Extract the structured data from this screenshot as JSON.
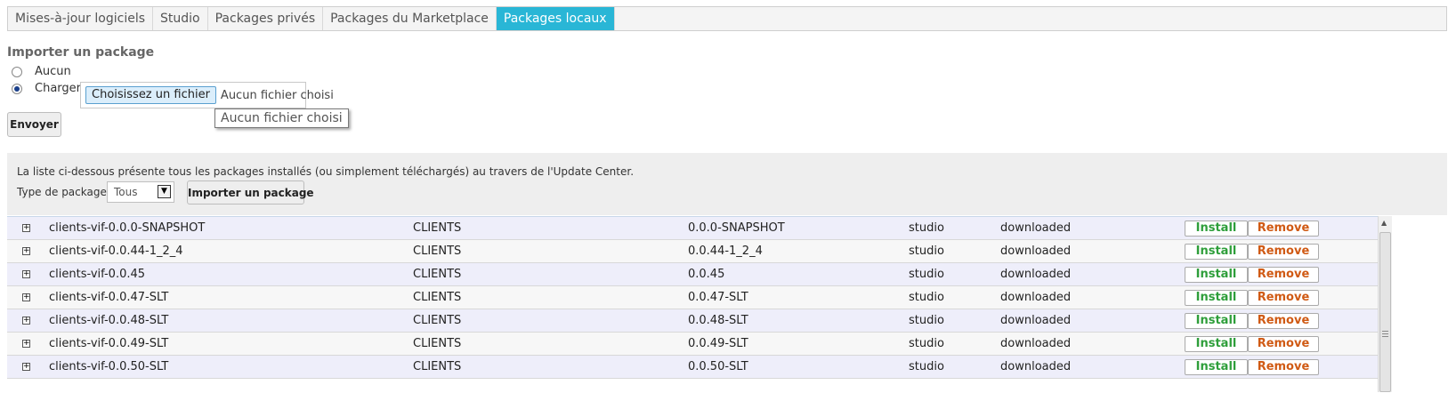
{
  "tabs": [
    {
      "label": "Mises-à-jour logiciels",
      "active": false
    },
    {
      "label": "Studio",
      "active": false
    },
    {
      "label": "Packages privés",
      "active": false
    },
    {
      "label": "Packages du Marketplace",
      "active": false
    },
    {
      "label": "Packages locaux",
      "active": true
    }
  ],
  "import": {
    "title": "Importer un package",
    "option_none": "Aucun",
    "option_upload": "Charger",
    "selected_option": "Charger",
    "file_button": "Choisissez un fichier",
    "file_status": "Aucun fichier choisi",
    "tooltip": "Aucun fichier choisi",
    "send_button": "Envoyer"
  },
  "panel": {
    "description": "La liste ci-dessous présente tous les packages installés (ou simplement téléchargés) au travers de l'Update Center.",
    "filter_label": "Type de package",
    "filter_value": "Tous",
    "import_button": "Importer un package"
  },
  "packages": [
    {
      "name": "clients-vif-0.0.0-SNAPSHOT",
      "type": "CLIENTS",
      "version": "0.0.0-SNAPSHOT",
      "target": "studio",
      "state": "downloaded"
    },
    {
      "name": "clients-vif-0.0.44-1_2_4",
      "type": "CLIENTS",
      "version": "0.0.44-1_2_4",
      "target": "studio",
      "state": "downloaded"
    },
    {
      "name": "clients-vif-0.0.45",
      "type": "CLIENTS",
      "version": "0.0.45",
      "target": "studio",
      "state": "downloaded"
    },
    {
      "name": "clients-vif-0.0.47-SLT",
      "type": "CLIENTS",
      "version": "0.0.47-SLT",
      "target": "studio",
      "state": "downloaded"
    },
    {
      "name": "clients-vif-0.0.48-SLT",
      "type": "CLIENTS",
      "version": "0.0.48-SLT",
      "target": "studio",
      "state": "downloaded"
    },
    {
      "name": "clients-vif-0.0.49-SLT",
      "type": "CLIENTS",
      "version": "0.0.49-SLT",
      "target": "studio",
      "state": "downloaded"
    },
    {
      "name": "clients-vif-0.0.50-SLT",
      "type": "CLIENTS",
      "version": "0.0.50-SLT",
      "target": "studio",
      "state": "downloaded"
    }
  ],
  "row_actions": {
    "install": "Install",
    "remove": "Remove"
  },
  "icons": {
    "expand": "expand-plus-icon",
    "dropdown": "dropdown-arrow-icon"
  },
  "colors": {
    "active_tab": "#29b6d6",
    "install": "#2e9e3a",
    "remove": "#d05a14"
  }
}
